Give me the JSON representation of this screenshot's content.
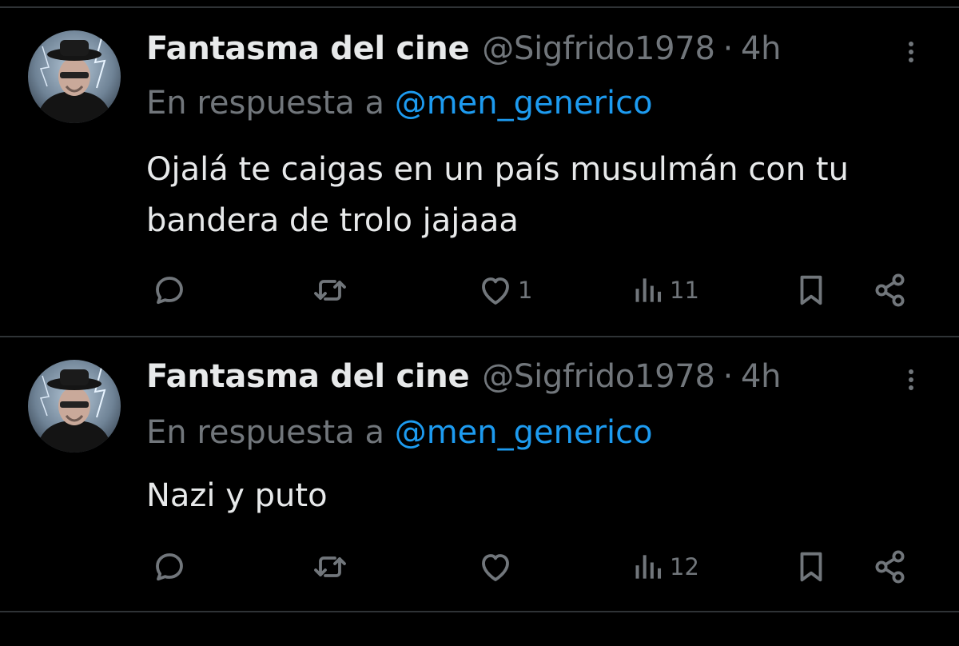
{
  "tweets": [
    {
      "display_name": "Fantasma del cine",
      "handle": "@Sigfrido1978",
      "separator": "·",
      "time": "4h",
      "reply_prefix": "En respuesta a",
      "reply_to": "@men_generico",
      "text": "Ojalá te caigas en un país musulmán con tu bandera de trolo jajaaa",
      "likes": "1",
      "views": "11"
    },
    {
      "display_name": "Fantasma del cine",
      "handle": "@Sigfrido1978",
      "separator": "·",
      "time": "4h",
      "reply_prefix": "En respuesta a",
      "reply_to": "@men_generico",
      "text": "Nazi y puto",
      "likes": "",
      "views": "12"
    }
  ],
  "icons": {
    "reply": "reply-icon",
    "retweet": "retweet-icon",
    "like": "heart-icon",
    "views": "bar-chart-icon",
    "bookmark": "bookmark-icon",
    "share": "share-icon",
    "more": "more-icon"
  },
  "colors": {
    "background": "#000000",
    "primary_text": "#e7e9ea",
    "secondary_text": "#71767b",
    "link": "#1d9bf0",
    "divider": "#2f3336"
  }
}
